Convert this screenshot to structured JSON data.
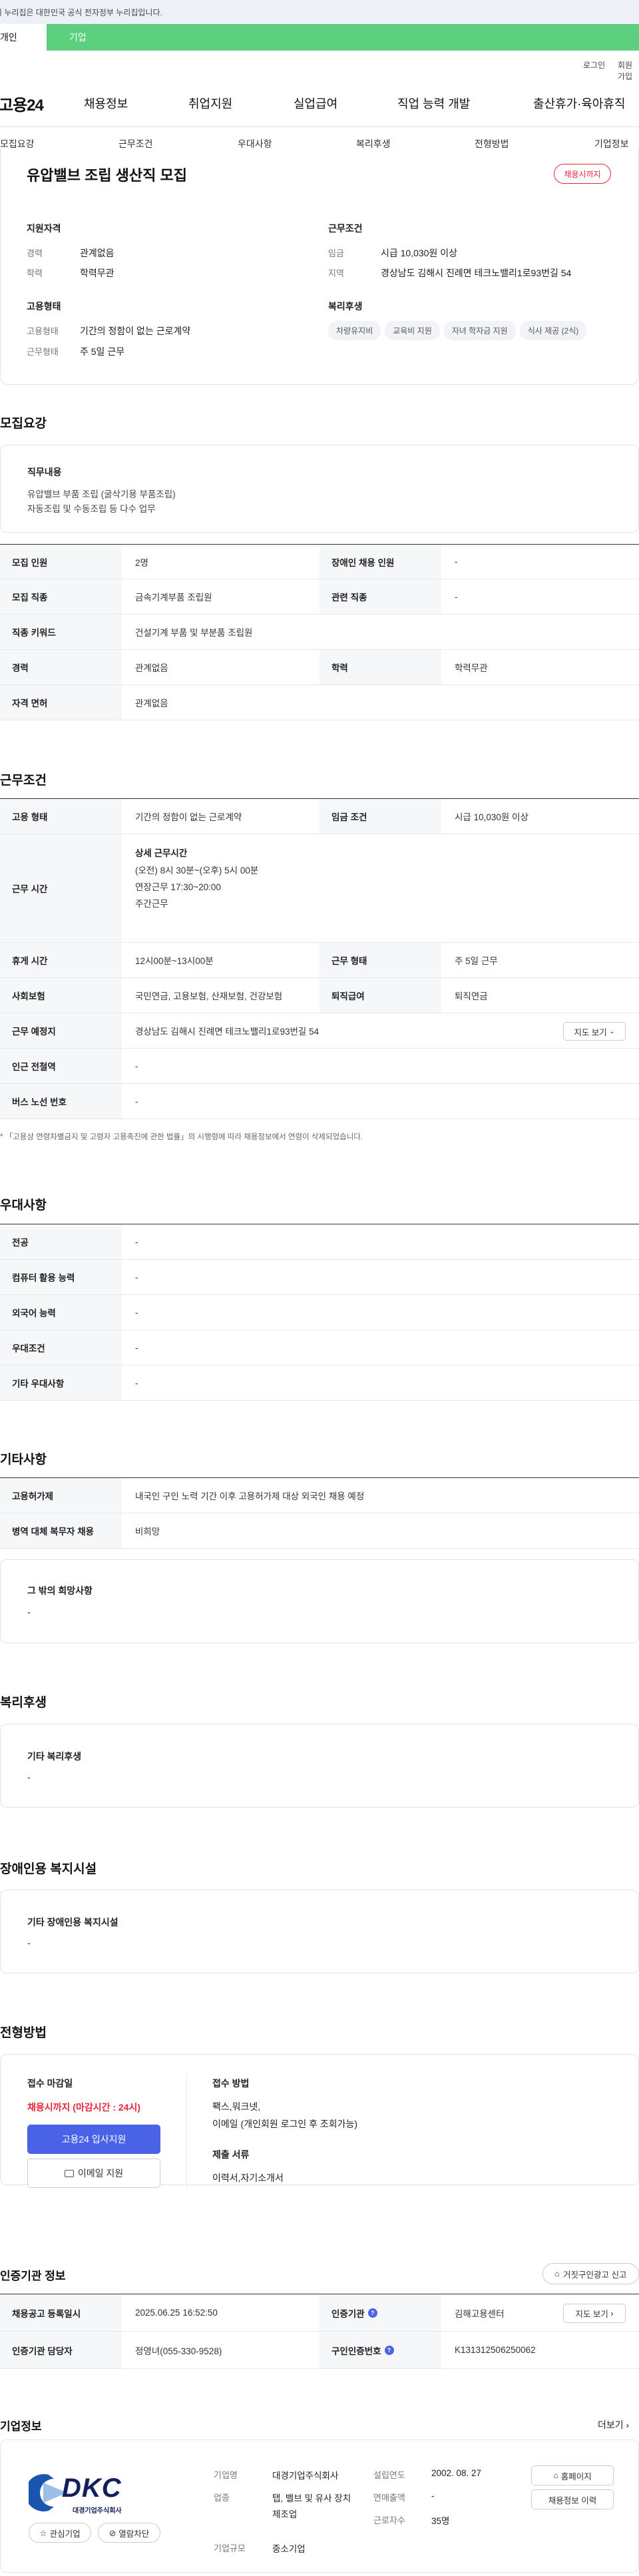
{
  "gov_banner": {
    "text": "이 누리집은 대한민국 공식 전자정부 누리집입니다."
  },
  "user_tabs": {
    "personal": "개인",
    "company": "기업"
  },
  "util": {
    "login": "로그인",
    "signup": "회원가입"
  },
  "logo": "고용24",
  "nav": [
    "채용정보",
    "취업지원",
    "실업급여",
    "직업 능력 개발",
    "출산휴가·육아휴직"
  ],
  "anchor_tabs": [
    "모집요강",
    "근무조건",
    "우대사항",
    "복리후생",
    "전형방법",
    "기업정보"
  ],
  "summary": {
    "title": "유압밸브 조립 생산직 모집",
    "badge": "채용시까지",
    "qualify_head": "지원자격",
    "career_label": "경력",
    "career_value": "관계없음",
    "edu_label": "학력",
    "edu_value": "학력무관",
    "emp_head": "고용형태",
    "emp_label": "고용형태",
    "emp_value": "기간의 정함이 없는 근로계약",
    "workform_label": "근무형태",
    "workform_value": "주 5일 근무",
    "cond_head": "근무조건",
    "wage_label": "임금",
    "wage_value": "시급 10,030원 이상",
    "area_label": "지역",
    "area_value": "경상남도 김해시 진례면 테크노밸리1로93번길 54",
    "welfare_head": "복리후생",
    "welfare_chips": [
      "차량유지비",
      "교육비 지원",
      "자녀 학자금 지원",
      "식사 제공 (2식)"
    ]
  },
  "recruit": {
    "heading": "모집요강",
    "duty_title": "직무내용",
    "duty_lines": [
      "유압밸브 부품 조립 (굴삭기용 부품조립)",
      "자동조립 및 수동조립 등 다수 업무"
    ],
    "rows": [
      {
        "l1": "모집 인원",
        "v1": "2명",
        "l2": "장애인 채용 인원",
        "v2": "-"
      },
      {
        "l1": "모집 직종",
        "v1": "금속기계부품 조립원",
        "l2": "관련 직종",
        "v2": "-"
      },
      {
        "l1": "직종 키워드",
        "v1": "건설기계 부품 및 부분품 조립원"
      },
      {
        "l1": "경력",
        "v1": "관계없음",
        "l2": "학력",
        "v2": "학력무관"
      },
      {
        "l1": "자격 면허",
        "v1": "관계없음"
      }
    ]
  },
  "work": {
    "heading": "근무조건",
    "emp_type_label": "고용 형태",
    "emp_type_value": "기간의 정함이 없는 근로계약",
    "wage_label": "임금 조건",
    "wage_value": "시급 10,030원 이상",
    "hours_label": "근무 시간",
    "hours_title": "상세 근무시간",
    "hours_lines": [
      "(오전) 8시 30분~(오후) 5시 00분",
      "연장근무 17:30~20:00",
      "주간근무"
    ],
    "break_label": "휴게 시간",
    "break_value": "12시00분~13시00분",
    "form_label": "근무 형태",
    "form_value": "주 5일 근무",
    "ins_label": "사회보험",
    "ins_value": "국민연금, 고용보험, 산재보험, 건강보험",
    "retire_label": "퇴직급여",
    "retire_value": "퇴직연금",
    "place_label": "근무 예정지",
    "place_value": "경상남도 김해시 진례면 테크노밸리1로93번길 54",
    "map_btn": "지도 보기",
    "subway_label": "인근 전철역",
    "subway_value": "-",
    "bus_label": "버스 노선 번호",
    "bus_value": "-",
    "note": "「고용상 연령차별금지 및 고령자 고용촉진에 관한 법률」의 시행령에 따라 채용정보에서 연령이 삭제되었습니다."
  },
  "pref": {
    "heading": "우대사항",
    "rows": [
      {
        "l": "전공",
        "v": "-"
      },
      {
        "l": "컴퓨터 활용 능력",
        "v": "-"
      },
      {
        "l": "외국어 능력",
        "v": "-"
      },
      {
        "l": "우대조건",
        "v": "-"
      },
      {
        "l": "기타 우대사항",
        "v": "-"
      }
    ]
  },
  "etc": {
    "heading": "기타사항",
    "rows": [
      {
        "l": "고용허가제",
        "v": "내국인 구인 노력 기간 이후 고용허가제 대상 외국인 채용 예정"
      },
      {
        "l": "병역 대체 복무자 채용",
        "v": "비희망"
      }
    ],
    "other_title": "그 밖의 희망사항",
    "other_value": "-"
  },
  "welfare": {
    "heading": "복리후생",
    "box_title": "기타 복리후생",
    "box_value": "-"
  },
  "disabled": {
    "heading": "장애인용 복지시설",
    "box_title": "기타 장애인용 복지시설",
    "box_value": "-"
  },
  "process": {
    "heading": "전형방법",
    "deadline_title": "접수 마감일",
    "deadline_value": "채용시까지 (마감시간 : 24시)",
    "apply_btn": "고용24 입사지원",
    "email_btn": "이메일 지원",
    "method_title": "접수 방법",
    "method_lines": [
      "팩스,워크넷,",
      "이메일 (개인회원 로그인 후 조회가능)"
    ],
    "docs_title": "제출 서류",
    "docs_value": "이력서,자기소개서"
  },
  "agency": {
    "heading": "인증기관 정보",
    "report_btn": "거짓구인광고 신고",
    "reg_label": "채용공고 등록일시",
    "reg_value": "2025.06.25 16:52:50",
    "org_label": "인증기관",
    "org_value": "김해고용센터",
    "map_btn": "지도 보기",
    "mgr_label": "인증기관 담당자",
    "mgr_value": "정영녀(055-330-9528)",
    "num_label": "구인인증번호",
    "num_value": "K131312506250062"
  },
  "company": {
    "heading": "기업정보",
    "more": "더보기",
    "logo_text": "DKC",
    "logo_sub": "대경기업주식회사",
    "fav_btn": "관심기업",
    "block_btn": "열람차단",
    "name_label": "기업명",
    "name_value": "대경기업주식회사",
    "ind_label": "업종",
    "ind_value": "탭, 밸브 및 유사 장치 제조업",
    "size_label": "기업규모",
    "size_value": "중소기업",
    "est_label": "설립연도",
    "est_value": "2002. 08. 27",
    "sales_label": "연매출액",
    "sales_value": "-",
    "emp_label": "근로자수",
    "emp_value": "35명",
    "home_btn": "홈페이지",
    "history_btn": "채용정보 이력"
  },
  "colors": {
    "accent": "#4a62e6",
    "green": "#5cd07e",
    "red": "#e8263b"
  }
}
